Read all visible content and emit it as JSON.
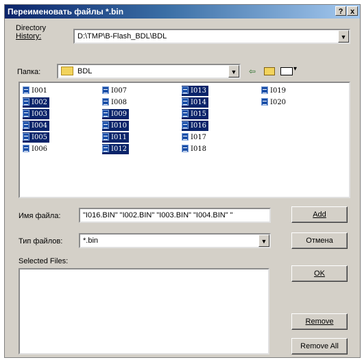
{
  "window": {
    "title": "Переименовать файлы *.bin",
    "help_btn": "?",
    "close_btn": "x"
  },
  "directory_history": {
    "label_line1": "Directory",
    "label_line2": "History:",
    "value": "D:\\TMP\\B-Flash_BDL\\BDL"
  },
  "folder": {
    "label": "Папка:",
    "value": "BDL"
  },
  "files": [
    {
      "name": "I001",
      "selected": false
    },
    {
      "name": "I002",
      "selected": true
    },
    {
      "name": "I003",
      "selected": true
    },
    {
      "name": "I004",
      "selected": true
    },
    {
      "name": "I005",
      "selected": true
    },
    {
      "name": "I006",
      "selected": false
    },
    {
      "name": "I007",
      "selected": false
    },
    {
      "name": "I008",
      "selected": false
    },
    {
      "name": "I009",
      "selected": true
    },
    {
      "name": "I010",
      "selected": true
    },
    {
      "name": "I011",
      "selected": true
    },
    {
      "name": "I012",
      "selected": true
    },
    {
      "name": "I013",
      "selected": true
    },
    {
      "name": "I014",
      "selected": true
    },
    {
      "name": "I015",
      "selected": true
    },
    {
      "name": "I016",
      "selected": true
    },
    {
      "name": "I017",
      "selected": false
    },
    {
      "name": "I018",
      "selected": false
    },
    {
      "name": "I019",
      "selected": false
    },
    {
      "name": "I020",
      "selected": false
    }
  ],
  "filename": {
    "label": "Имя файла:",
    "value": "\"I016.BIN\" \"I002.BIN\" \"I003.BIN\" \"I004.BIN\" \""
  },
  "filetype": {
    "label": "Тип файлов:",
    "value": "*.bin"
  },
  "selected_files": {
    "label": "Selected Files:"
  },
  "buttons": {
    "add": "Add",
    "cancel": "Отмена",
    "ok": "OK",
    "remove": "Remove",
    "remove_all": "Remove All"
  },
  "colors": {
    "selection": "#0a246a",
    "dialog_bg": "#d4d0c8"
  }
}
